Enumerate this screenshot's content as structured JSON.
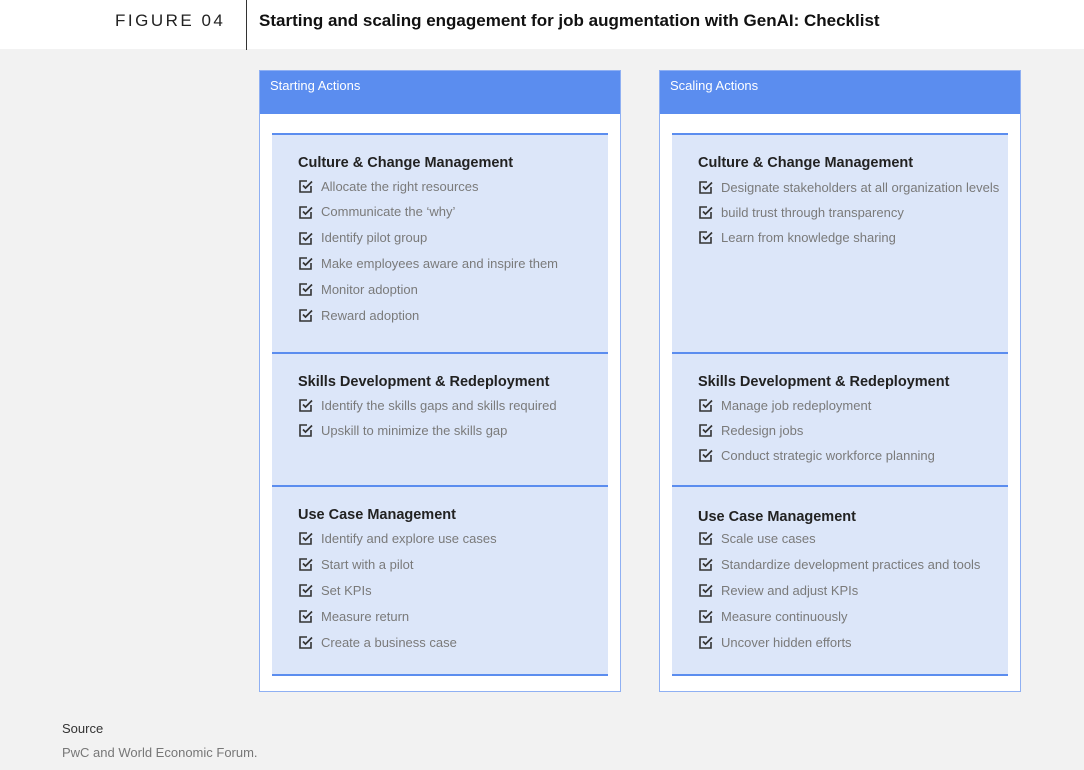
{
  "figure": {
    "label": "FIGURE 04",
    "title": "Starting and scaling engagement for job augmentation with GenAI: Checklist"
  },
  "columns": [
    {
      "heading": "Starting Actions",
      "sections": [
        {
          "title": "Culture & Change Management",
          "items": [
            "Allocate the right resources",
            "Communicate the ‘why’",
            "Identify pilot group",
            "Make employees aware and inspire them",
            "Monitor adoption",
            "Reward adoption"
          ]
        },
        {
          "title": "Skills Development & Redeployment",
          "items": [
            "Identify the skills gaps and skills required",
            "Upskill to minimize the skills gap"
          ]
        },
        {
          "title": "Use Case Management",
          "items": [
            "Identify and explore use cases",
            "Start with a pilot",
            "Set KPIs",
            "Measure return",
            "Create a business case"
          ]
        }
      ]
    },
    {
      "heading": "Scaling Actions",
      "sections": [
        {
          "title": "Culture & Change Management",
          "items": [
            "Designate stakeholders at all organization levels",
            "build trust through transparency",
            "Learn from knowledge sharing"
          ]
        },
        {
          "title": "Skills Development & Redeployment",
          "items": [
            "Manage job redeployment",
            "Redesign jobs",
            "Conduct strategic workforce planning"
          ]
        },
        {
          "title": "Use Case Management",
          "items": [
            "Scale use cases",
            "Standardize development practices and tools",
            "Review and adjust KPIs",
            "Measure continuously",
            "Uncover hidden efforts"
          ]
        }
      ]
    }
  ],
  "source": {
    "title": "Source",
    "text": "PwC and World Economic Forum."
  },
  "colors": {
    "accent": "#5b8def",
    "panel": "#dce6f9",
    "background": "#f2f2f2"
  }
}
